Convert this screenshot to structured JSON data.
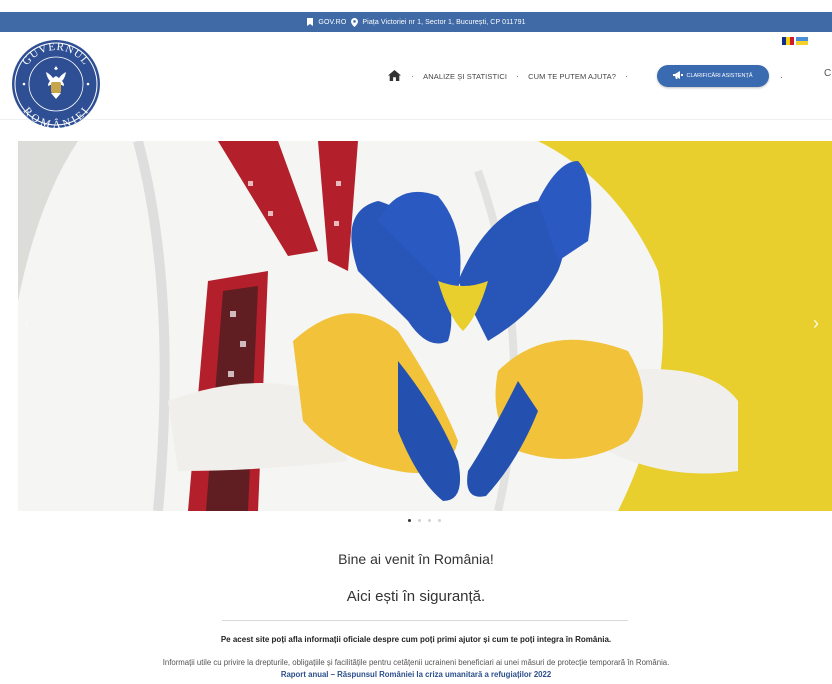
{
  "topbar": {
    "gov_link": "GOV.RO",
    "address": "Piața Victoriei nr 1, Sector 1, București, CP 011791",
    "bg_color": "#3f6aa6"
  },
  "header": {
    "logo_text_top": "GUVERNUL",
    "logo_text_bottom": "ROMÂNIEI",
    "flags": [
      "romanian-flag-icon",
      "ukrainian-flag-icon"
    ],
    "nav": {
      "home_icon": "home-icon",
      "items": [
        "ANALIZE ȘI STATISTICI",
        "CUM TE PUTEM AJUTA?"
      ],
      "button_label": "CLARIFICĂRI ASISTENȚĂ",
      "button_icon": "megaphone-icon",
      "button_color": "#3a6bb0",
      "trailing_char": "C"
    }
  },
  "hero": {
    "slides": 4,
    "active_slide": 1,
    "prev_icon": "chevron-left-icon",
    "next_icon": "chevron-right-icon"
  },
  "content": {
    "title": "Bine ai venit în România!",
    "subtitle": "Aici ești în siguranță.",
    "intro": "Pe acest site poți afla informații oficiale despre cum poți primi ajutor și cum te poți integra în România.",
    "info": "Informații utile cu privire la drepturile, obligațiile și facilitățile pentru cetățenii ucraineni beneficiari ai unei măsuri de protecție temporară în România.",
    "report_link": "Raport anual – Răspunsul României la criza umanitară a refugiaților 2022"
  }
}
